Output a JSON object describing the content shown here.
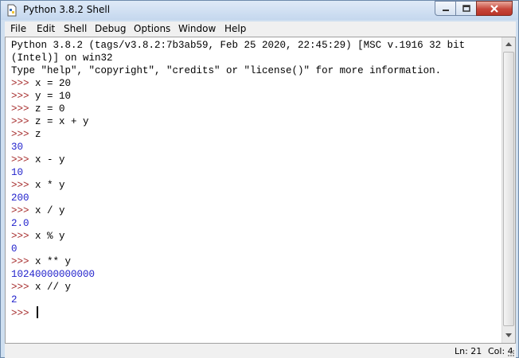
{
  "window": {
    "title": "Python 3.8.2 Shell",
    "controls": {
      "minimize": "minimize",
      "maximize": "maximize",
      "close": "close"
    }
  },
  "menubar": {
    "items": [
      "File",
      "Edit",
      "Shell",
      "Debug",
      "Options",
      "Window",
      "Help"
    ]
  },
  "shell": {
    "lines": [
      {
        "kind": "out",
        "text": "Python 3.8.2 (tags/v3.8.2:7b3ab59, Feb 25 2020, 22:45:29) [MSC v.1916 32 bit"
      },
      {
        "kind": "out",
        "text": "(Intel)] on win32"
      },
      {
        "kind": "out",
        "text": "Type \"help\", \"copyright\", \"credits\" or \"license()\" for more information."
      },
      {
        "kind": "in",
        "prompt": ">>> ",
        "code": "x = 20"
      },
      {
        "kind": "in",
        "prompt": ">>> ",
        "code": "y = 10"
      },
      {
        "kind": "in",
        "prompt": ">>> ",
        "code": "z = 0"
      },
      {
        "kind": "in",
        "prompt": ">>> ",
        "code": "z = x + y"
      },
      {
        "kind": "in",
        "prompt": ">>> ",
        "code": "z"
      },
      {
        "kind": "res",
        "text": "30"
      },
      {
        "kind": "in",
        "prompt": ">>> ",
        "code": "x - y"
      },
      {
        "kind": "res",
        "text": "10"
      },
      {
        "kind": "in",
        "prompt": ">>> ",
        "code": "x * y"
      },
      {
        "kind": "res",
        "text": "200"
      },
      {
        "kind": "in",
        "prompt": ">>> ",
        "code": "x / y"
      },
      {
        "kind": "res",
        "text": "2.0"
      },
      {
        "kind": "in",
        "prompt": ">>> ",
        "code": "x % y"
      },
      {
        "kind": "res",
        "text": "0"
      },
      {
        "kind": "in",
        "prompt": ">>> ",
        "code": "x ** y"
      },
      {
        "kind": "res",
        "text": "10240000000000"
      },
      {
        "kind": "in",
        "prompt": ">>> ",
        "code": "x // y"
      },
      {
        "kind": "res",
        "text": "2"
      },
      {
        "kind": "cur",
        "prompt": ">>> ",
        "code": ""
      }
    ]
  },
  "status": {
    "line": "Ln: 21",
    "col": "Col: 4"
  },
  "colors": {
    "prompt": "#a52a2a",
    "result": "#2222cc",
    "text": "#000000"
  }
}
